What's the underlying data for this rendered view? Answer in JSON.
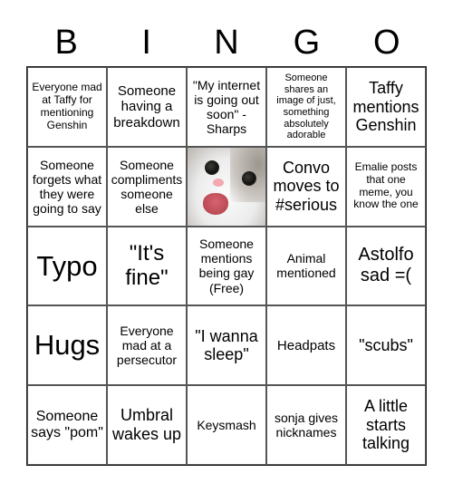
{
  "header": {
    "letters": [
      "B",
      "I",
      "N",
      "G",
      "O"
    ]
  },
  "card": {
    "cells": [
      [
        "Everyone mad at Taffy for mentioning Genshin",
        "Someone having a breakdown",
        "\"My internet is going out soon\" - Sharps",
        "Someone shares an image of just, something absolutely adorable",
        "Taffy mentions Genshin"
      ],
      [
        "Someone forgets what they were going to say",
        "Someone compliments someone else",
        "",
        "Convo moves to #serious",
        "Emalie posts that one meme, you know the one"
      ],
      [
        "Typo",
        "\"It's fine\"",
        "Someone mentions being gay (Free)",
        "Animal mentioned",
        "Astolfo sad =("
      ],
      [
        "Hugs",
        "Everyone mad at a persecutor",
        "\"I wanna sleep\"",
        "Headpats",
        "\"scubs\""
      ],
      [
        "Someone says \"pom\"",
        "Umbral wakes up",
        "Keysmash",
        "sonja gives nicknames",
        "A little starts talking"
      ]
    ],
    "center_image": "cat-photo"
  }
}
